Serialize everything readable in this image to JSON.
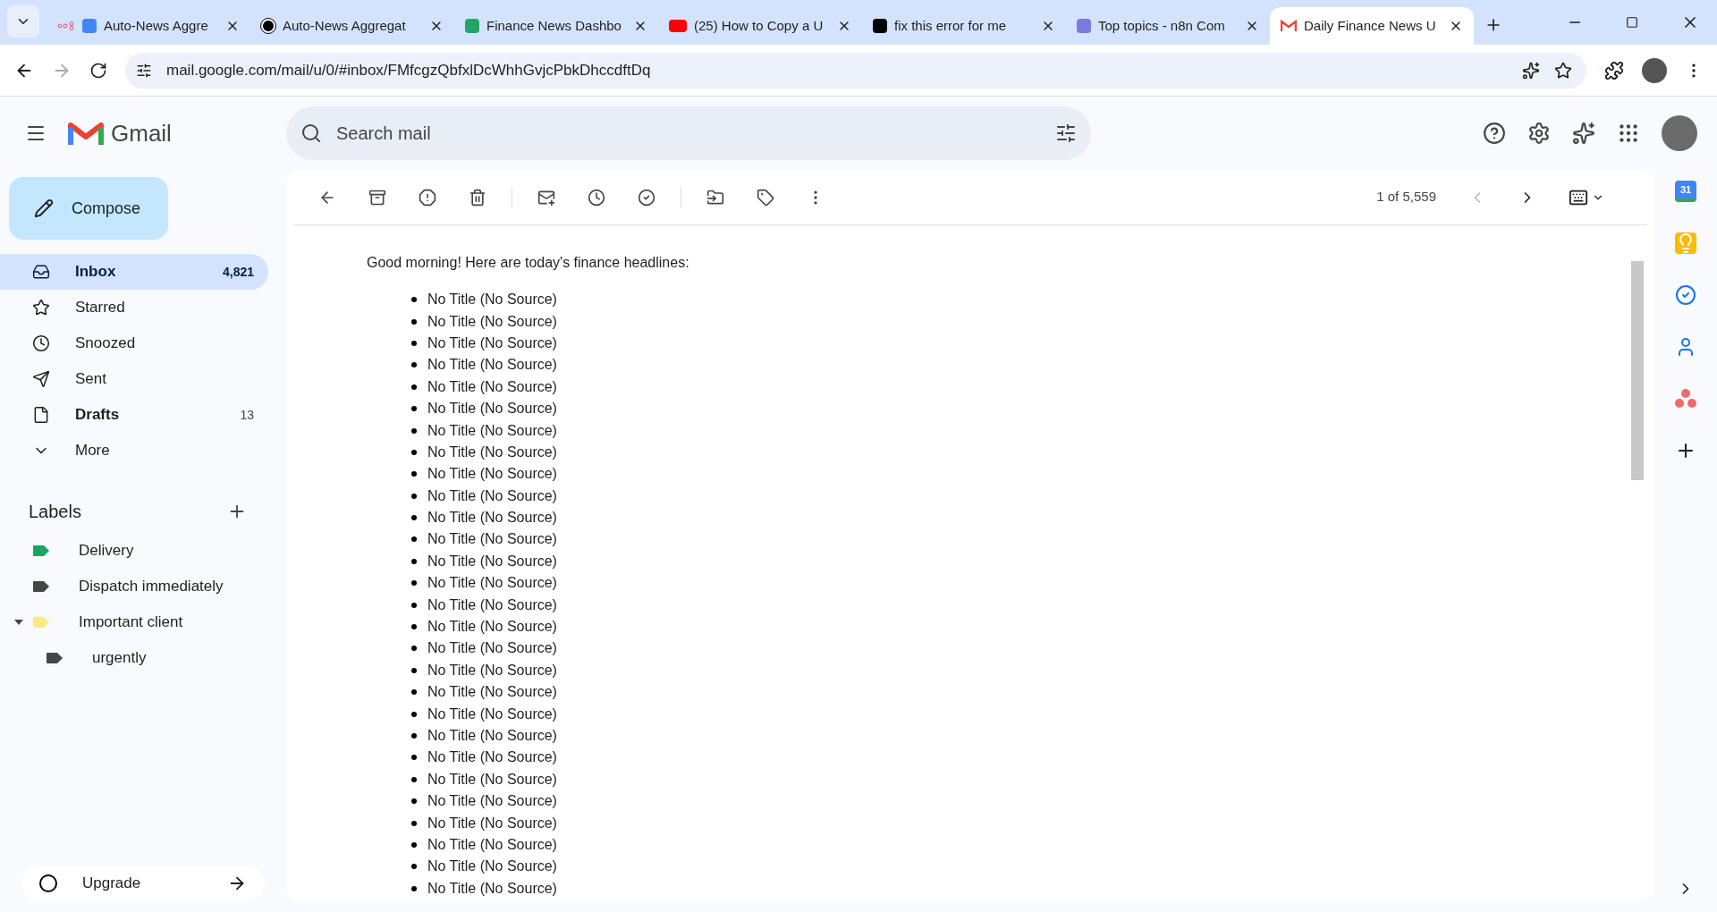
{
  "browser": {
    "tabs": [
      {
        "title": "Auto-News Aggre",
        "kind": "n8n-sync",
        "selected": false
      },
      {
        "title": "Auto-News Aggregat",
        "kind": "openai",
        "selected": false
      },
      {
        "title": "Finance News Dashbo",
        "kind": "sheets",
        "selected": false
      },
      {
        "title": "(25) How to Copy a U",
        "kind": "youtube",
        "selected": false
      },
      {
        "title": "fix this error for me",
        "kind": "dark",
        "selected": false
      },
      {
        "title": "Top topics - n8n Com",
        "kind": "n8n",
        "selected": false
      },
      {
        "title": "Daily Finance News U",
        "kind": "gmail",
        "selected": true
      }
    ],
    "url": "mail.google.com/mail/u/0/#inbox/FMfcgzQbfxlDcWhhGvjcPbkDhccdftDq"
  },
  "gmail": {
    "logo_text": "Gmail",
    "search": {
      "placeholder": "Search mail"
    },
    "compose": "Compose",
    "nav": [
      {
        "label": "Inbox",
        "count": "4,821",
        "kind": "inbox",
        "selected": true,
        "bold": true
      },
      {
        "label": "Starred",
        "kind": "star",
        "selected": false,
        "bold": false
      },
      {
        "label": "Snoozed",
        "kind": "clock",
        "selected": false,
        "bold": false
      },
      {
        "label": "Sent",
        "kind": "send",
        "selected": false,
        "bold": false
      },
      {
        "label": "Drafts",
        "count": "13",
        "kind": "file",
        "selected": false,
        "bold": true
      },
      {
        "label": "More",
        "kind": "chevron",
        "selected": false,
        "bold": false
      }
    ],
    "labels_title": "Labels",
    "labels": [
      {
        "label": "Delivery",
        "color": "#16a765"
      },
      {
        "label": "Dispatch immediately",
        "color": "#444746"
      },
      {
        "label": "Important client",
        "color": "#fbe983",
        "expanded": true,
        "children": [
          {
            "label": "urgently",
            "color": "#444746"
          }
        ]
      }
    ],
    "upgrade": "Upgrade",
    "pager": "1 of 5,559",
    "calendar_day": "31",
    "message": {
      "greeting": "Good morning! Here are today's finance headlines:",
      "items": [
        "No Title (No Source)",
        "No Title (No Source)",
        "No Title (No Source)",
        "No Title (No Source)",
        "No Title (No Source)",
        "No Title (No Source)",
        "No Title (No Source)",
        "No Title (No Source)",
        "No Title (No Source)",
        "No Title (No Source)",
        "No Title (No Source)",
        "No Title (No Source)",
        "No Title (No Source)",
        "No Title (No Source)",
        "No Title (No Source)",
        "No Title (No Source)",
        "No Title (No Source)",
        "No Title (No Source)",
        "No Title (No Source)",
        "No Title (No Source)",
        "No Title (No Source)",
        "No Title (No Source)",
        "No Title (No Source)",
        "No Title (No Source)",
        "No Title (No Source)",
        "No Title (No Source)",
        "No Title (No Source)",
        "No Title (No Source)"
      ]
    }
  }
}
